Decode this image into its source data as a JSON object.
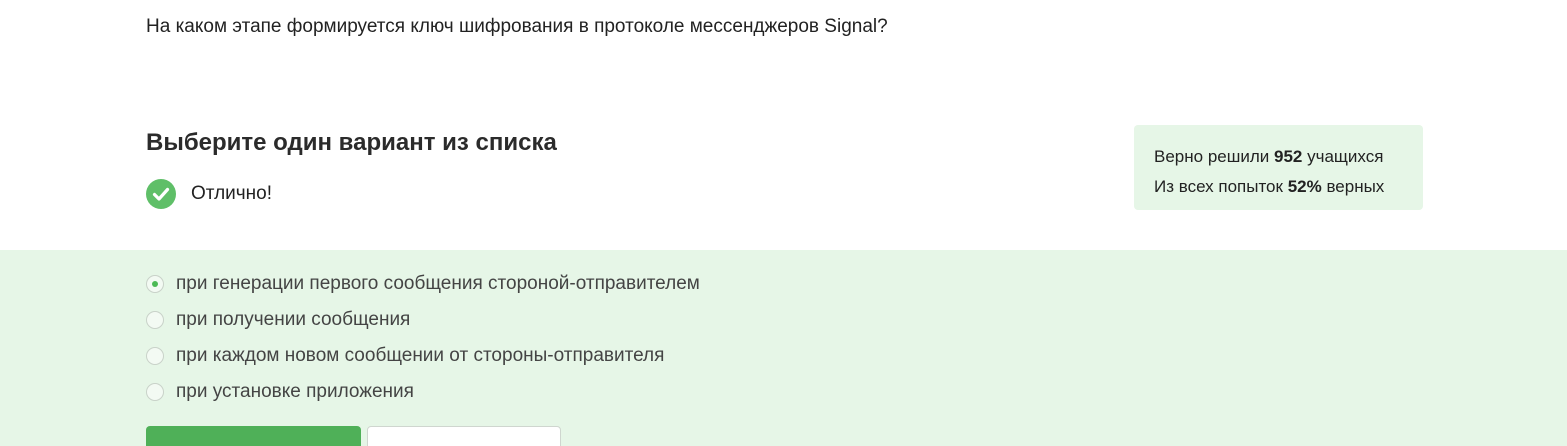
{
  "question": {
    "text": "На каком этапе формируется ключ шифрования в протоколе мессенджеров Signal?"
  },
  "task": {
    "title": "Выберите один вариант из списка"
  },
  "result": {
    "icon": "check-circle-icon",
    "text": "Отлично!",
    "color": "#5fbf68"
  },
  "stats": {
    "line1_prefix": "Верно решили ",
    "line1_value": "952",
    "line1_suffix": " учащихся",
    "line2_prefix": "Из всех попыток ",
    "line2_value": "52%",
    "line2_suffix": " верных",
    "background": "#e6f6e7"
  },
  "options": [
    {
      "label": "при генерации первого сообщения стороной-отправителем",
      "selected": true
    },
    {
      "label": "при получении сообщения",
      "selected": false
    },
    {
      "label": "при каждом новом сообщении от стороны-отправителя",
      "selected": false
    },
    {
      "label": "при установке приложения",
      "selected": false
    }
  ],
  "colors": {
    "accent_green": "#4fb058",
    "answers_background": "#e6f6e7"
  }
}
